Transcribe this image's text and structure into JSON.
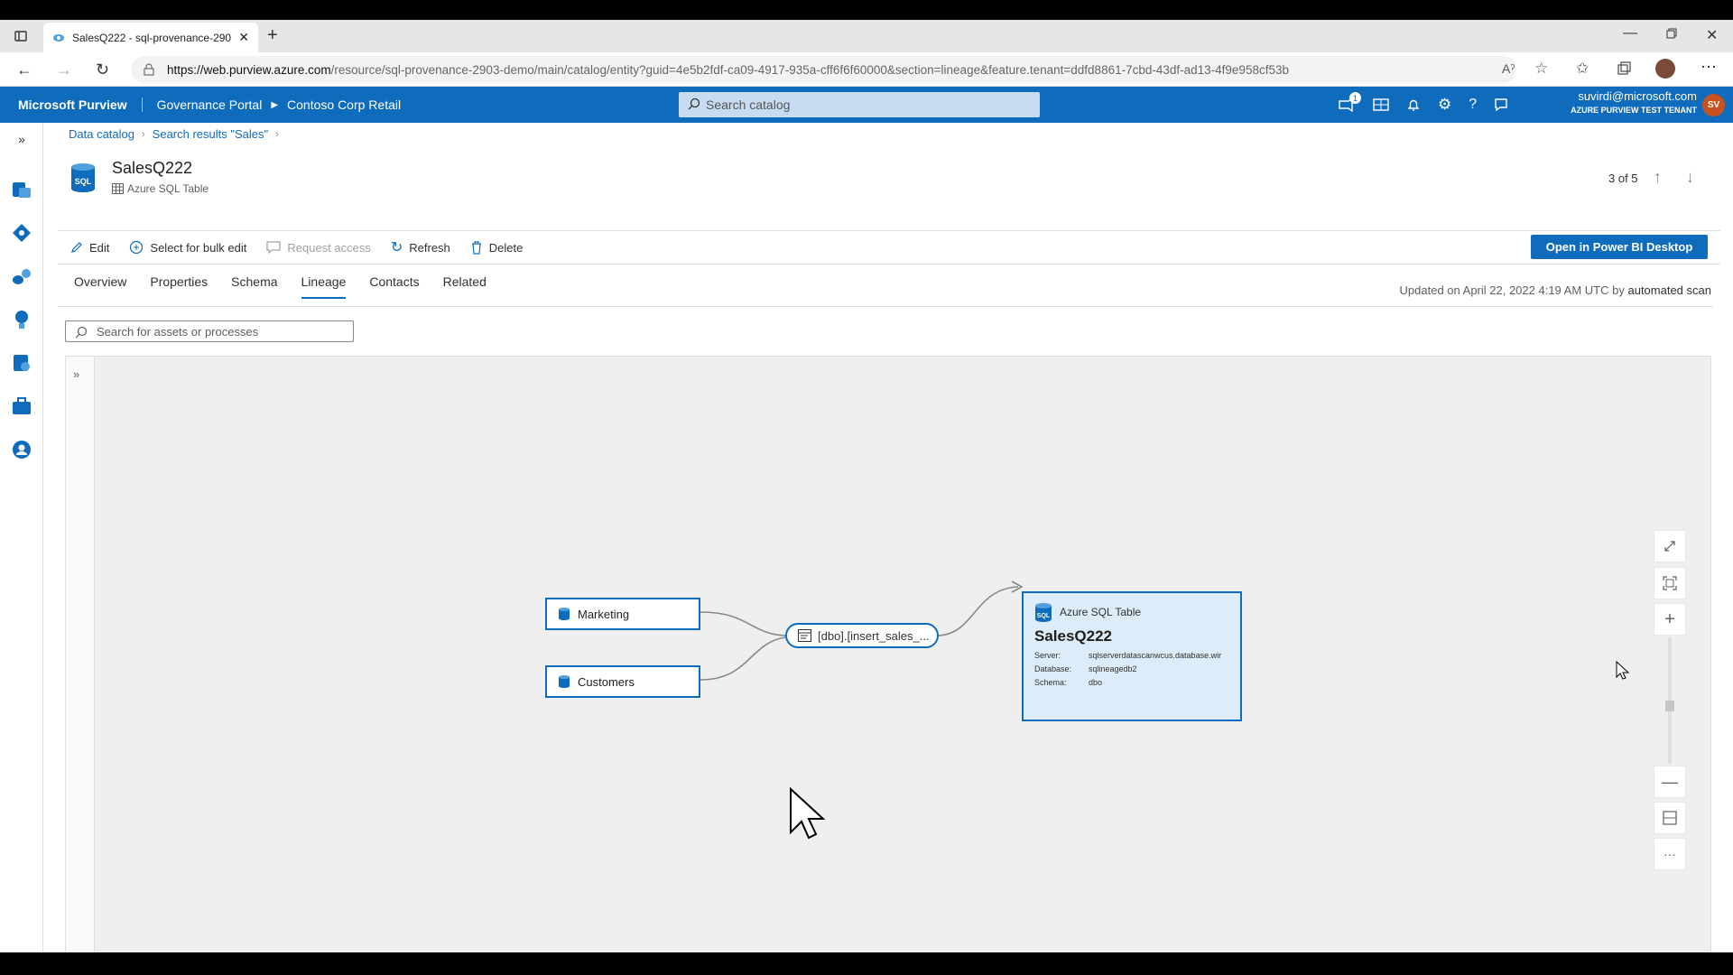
{
  "browser": {
    "tab_title": "SalesQ222 - sql-provenance-290",
    "url_host": "https://web.purview.azure.com",
    "url_path": "/resource/sql-provenance-2903-demo/main/catalog/entity?guid=4e5b2fdf-ca09-4917-935a-cff6f6f60000&section=lineage&feature.tenant=ddfd8861-7cbd-43df-ad13-4f9e958cf53b"
  },
  "header": {
    "brand": "Microsoft Purview",
    "portal": "Governance Portal",
    "org": "Contoso Corp Retail",
    "search_placeholder": "Search catalog",
    "notif_count": "1",
    "user_email": "suvirdi@microsoft.com",
    "tenant": "AZURE PURVIEW TEST TENANT",
    "avatar_initials": "SV",
    "accent": "#0f6cbd"
  },
  "breadcrumb": {
    "items": [
      "Data catalog",
      "Search results \"Sales\""
    ]
  },
  "asset": {
    "name": "SalesQ222",
    "type": "Azure SQL Table",
    "position": "3 of 5"
  },
  "toolbar": {
    "edit": "Edit",
    "bulk_edit": "Select for bulk edit",
    "request_access": "Request access",
    "refresh": "Refresh",
    "delete": "Delete",
    "open_pbi": "Open in Power BI Desktop"
  },
  "tabs": [
    "Overview",
    "Properties",
    "Schema",
    "Lineage",
    "Contacts",
    "Related"
  ],
  "active_tab": "Lineage",
  "updated": {
    "prefix": "Updated on April 22, 2022 4:19 AM UTC by",
    "by": "automated scan"
  },
  "lineage": {
    "search_placeholder": "Search for assets or processes",
    "sources": [
      "Marketing",
      "Customers"
    ],
    "process": "[dbo].[insert_sales_...",
    "target": {
      "type": "Azure SQL Table",
      "name": "SalesQ222",
      "server_label": "Server:",
      "server": "sqlserverdatascanwcus.database.wir",
      "database_label": "Database:",
      "database": "sqlineagedb2",
      "schema_label": "Schema:",
      "schema": "dbo"
    }
  }
}
